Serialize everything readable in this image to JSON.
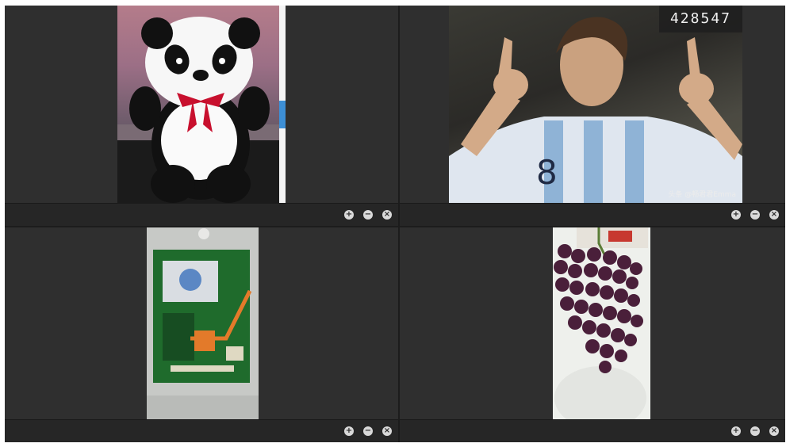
{
  "viewers": [
    {
      "id": "panda",
      "image_label": "panda plush toy photo",
      "toolbar": {
        "zoom_in": "+",
        "zoom_out": "−",
        "close": "×"
      }
    },
    {
      "id": "messi",
      "image_label": "soccer player photo",
      "counter_value": "428547",
      "watermark": "头条 @畅君君Emma",
      "toolbar": {
        "zoom_in": "+",
        "zoom_out": "−",
        "close": "×"
      }
    },
    {
      "id": "board",
      "image_label": "circuit board photo",
      "toolbar": {
        "zoom_in": "+",
        "zoom_out": "−",
        "close": "×"
      }
    },
    {
      "id": "grapes",
      "image_label": "grapes photo",
      "toolbar": {
        "zoom_in": "+",
        "zoom_out": "−",
        "close": "×"
      }
    }
  ],
  "colors": {
    "panel_bg": "#2f2f2f",
    "toolbar_bg": "#262626",
    "button_fg": "#d9d9d9"
  },
  "icons": [
    "zoom-in-icon",
    "zoom-out-icon",
    "close-icon"
  ]
}
